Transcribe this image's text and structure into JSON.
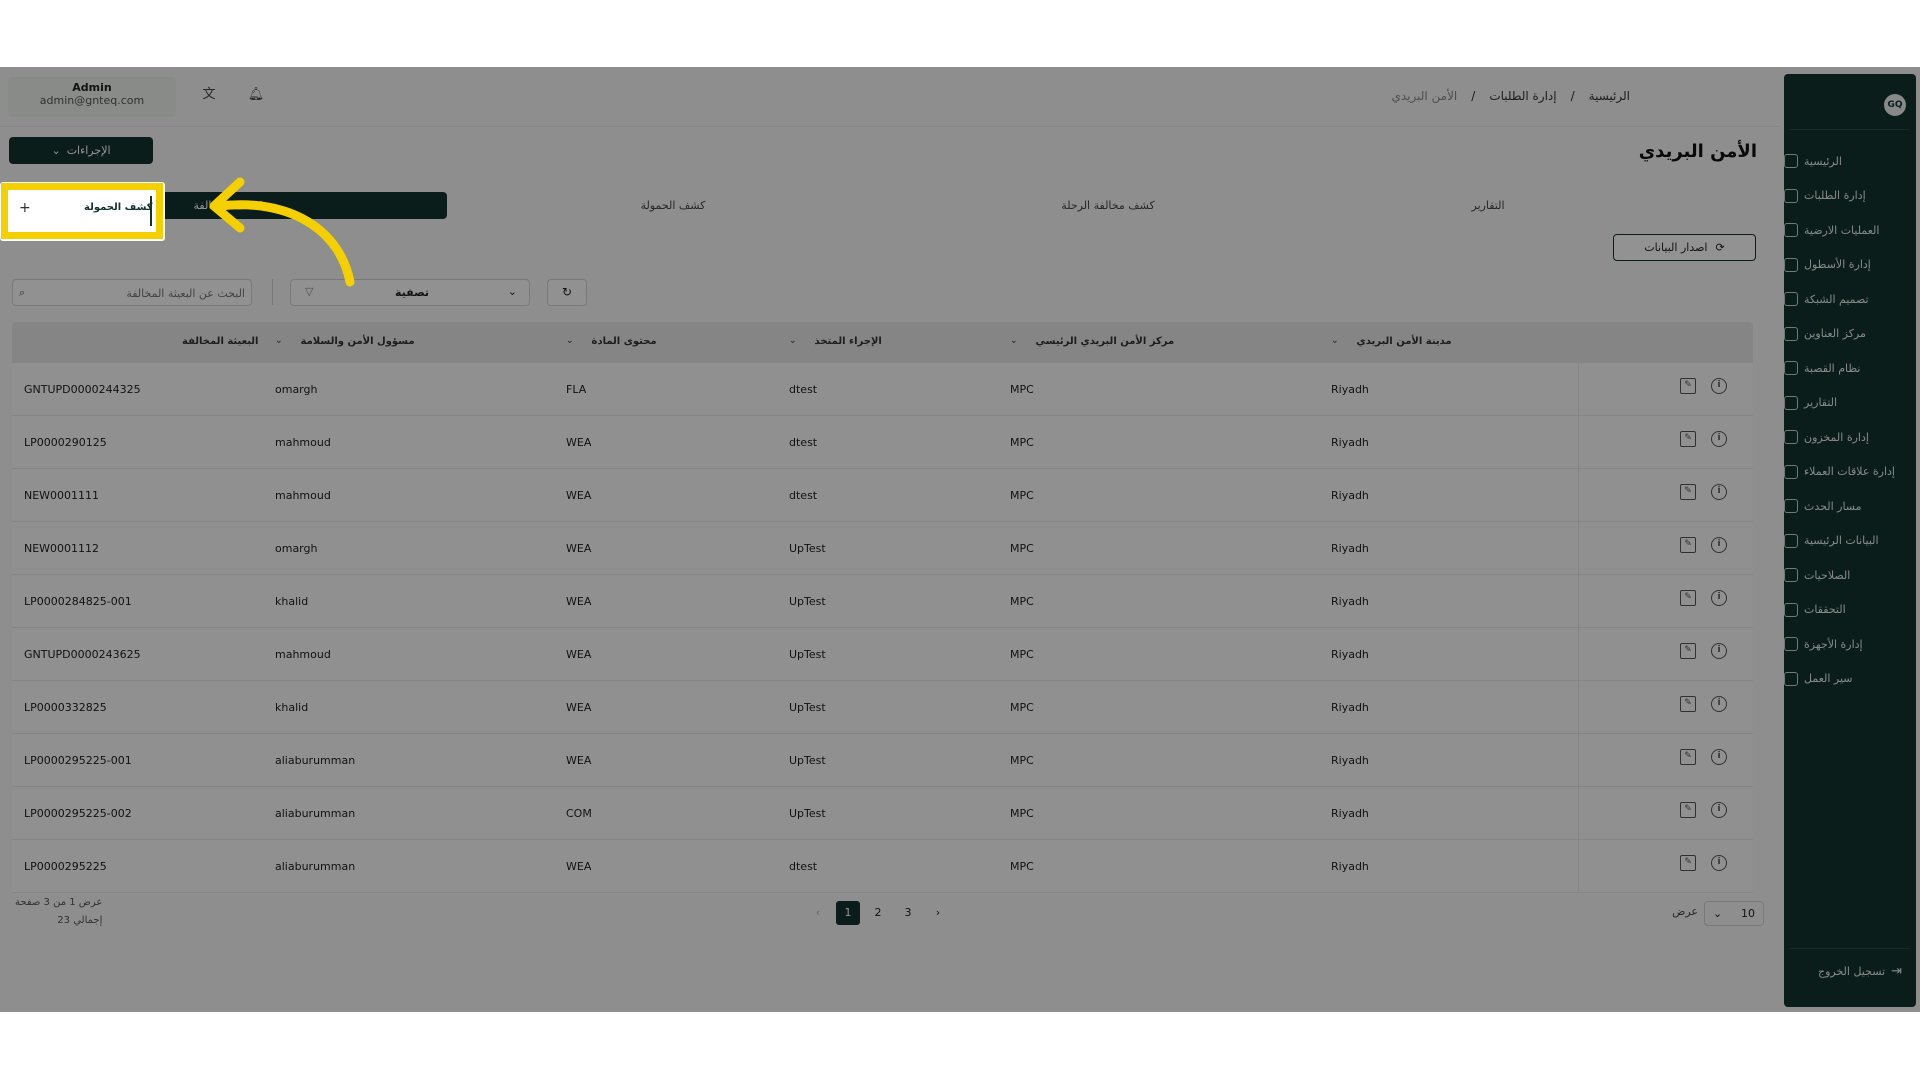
{
  "user": {
    "name": "Admin",
    "email": "admin@gnteq.com"
  },
  "breadcrumb": [
    "الرئيسية",
    "/",
    "إدارة الطلبات",
    "/",
    "الأمن البريدي"
  ],
  "page_title": "الأمن البريدي",
  "actions_label": "الإجراءات",
  "tabs": [
    "التقارير",
    "كشف مخالفة الرحلة",
    "كشف الحمولة",
    "كشف المخالفة"
  ],
  "export_label": "اصدار البيانات",
  "search_placeholder": "البحث عن البعيثة المخالفة",
  "filter_label": "تصفية",
  "dropdown_item": "كشف الحمولة",
  "sidebar": {
    "logo": "GQ",
    "items": [
      "الرئيسية",
      "إدارة الطلبات",
      "العمليات الارضية",
      "إدارة الأسطول",
      "تصميم الشبكة",
      "مركز العناوين",
      "نظام القصبة",
      "التقارير",
      "إدارة المخزون",
      "إدارة علاقات العملاء",
      "مسار الحدث",
      "البيانات الرئيسية",
      "الصلاحيات",
      "التحققات",
      "إدارة الأجهزة",
      "سير العمل"
    ],
    "logout": "تسجيل الخروج"
  },
  "table": {
    "headers": [
      "مدينة الأمن البريدي",
      "مركز الأمن البريدي الرئيسي",
      "الإجراء المتخذ",
      "محتوى المادة",
      "مسؤول الأمن والسلامة",
      "البعيثة المخالفة"
    ],
    "rows": [
      [
        "Riyadh",
        "MPC",
        "dtest",
        "FLA",
        "omargh",
        "GNTUPD0000244325"
      ],
      [
        "Riyadh",
        "MPC",
        "dtest",
        "WEA",
        "mahmoud",
        "LP0000290125"
      ],
      [
        "Riyadh",
        "MPC",
        "dtest",
        "WEA",
        "mahmoud",
        "NEW0001111"
      ],
      [
        "Riyadh",
        "MPC",
        "UpTest",
        "WEA",
        "omargh",
        "NEW0001112"
      ],
      [
        "Riyadh",
        "MPC",
        "UpTest",
        "WEA",
        "khalid",
        "LP0000284825-001"
      ],
      [
        "Riyadh",
        "MPC",
        "UpTest",
        "WEA",
        "mahmoud",
        "GNTUPD0000243625"
      ],
      [
        "Riyadh",
        "MPC",
        "UpTest",
        "WEA",
        "khalid",
        "LP0000332825"
      ],
      [
        "Riyadh",
        "MPC",
        "UpTest",
        "WEA",
        "aliaburumman",
        "LP0000295225-001"
      ],
      [
        "Riyadh",
        "MPC",
        "UpTest",
        "COM",
        "aliaburumman",
        "LP0000295225-002"
      ],
      [
        "Riyadh",
        "MPC",
        "dtest",
        "WEA",
        "aliaburumman",
        "LP0000295225"
      ]
    ]
  },
  "footer": {
    "page_info": "عرض 1 من 3 صفحة",
    "total": "إجمالي 23",
    "pages": [
      "1",
      "2",
      "3"
    ],
    "next": "›",
    "prev": "‹",
    "per_page_label": "عرض",
    "per_page_value": "10"
  },
  "colors": {
    "primary": "#13332f",
    "highlight": "#f5d000"
  }
}
